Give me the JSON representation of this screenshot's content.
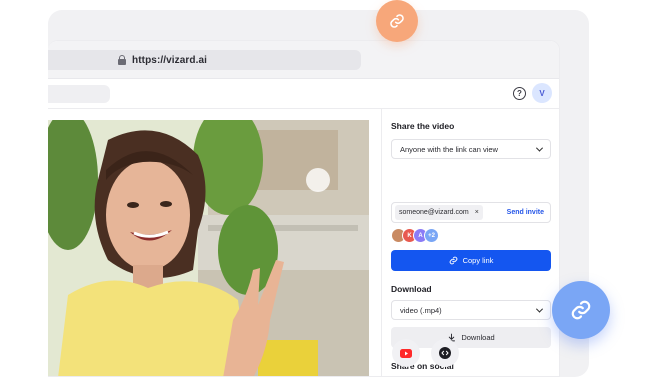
{
  "browser": {
    "url": "https://vizard.ai"
  },
  "header": {
    "help_icon": "question-circle-icon",
    "avatar_initial": "V"
  },
  "share_panel": {
    "title": "Share the video",
    "access_select": "Anyone with the link can view",
    "invite": {
      "email_chip": "someone@vizard.com",
      "chip_remove": "×",
      "send_label": "Send invite"
    },
    "collaborators": [
      {
        "label": "",
        "color": "#c98a62"
      },
      {
        "label": "K",
        "color": "#e85a4f"
      },
      {
        "label": "A",
        "color": "#8b7cf6"
      },
      {
        "label": "+2",
        "color": "#7aa6f5"
      }
    ],
    "copy_link_label": "Copy link",
    "download_title": "Download",
    "format_select": "video (.mp4)",
    "download_label": "Download",
    "social_title": "Share on social",
    "social_icons": [
      "youtube-icon",
      "code-embed-icon"
    ]
  },
  "colors": {
    "primary": "#1456f0",
    "accent_orange": "#f7a77a",
    "accent_blue": "#7aa6f5"
  }
}
